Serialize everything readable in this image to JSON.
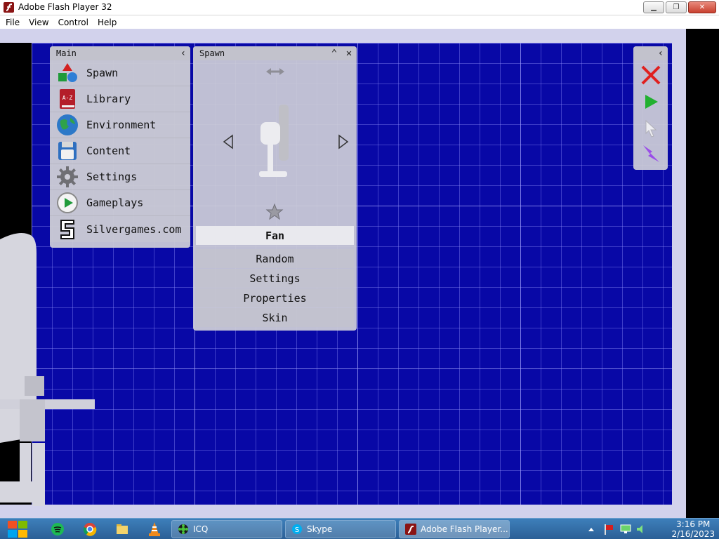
{
  "window": {
    "title": "Adobe Flash Player 32",
    "controls": [
      "minimize-icon",
      "restore-icon",
      "close-icon"
    ]
  },
  "menu": [
    "File",
    "View",
    "Control",
    "Help"
  ],
  "main_panel": {
    "title": "Main",
    "items": [
      {
        "label": "Spawn",
        "icon": "spawn-shapes-icon"
      },
      {
        "label": "Library",
        "icon": "book-icon"
      },
      {
        "label": "Environment",
        "icon": "globe-icon"
      },
      {
        "label": "Content",
        "icon": "floppy-disk-icon"
      },
      {
        "label": "Settings",
        "icon": "gear-icon"
      },
      {
        "label": "Gameplays",
        "icon": "play-icon"
      },
      {
        "label": "Silvergames.com",
        "icon": "silvergames-logo-icon"
      }
    ]
  },
  "spawn_panel": {
    "title": "Spawn",
    "selected": "Fan",
    "options": [
      "Random",
      "Settings",
      "Properties",
      "Skin"
    ]
  },
  "tools": [
    "delete-icon",
    "play-icon",
    "cursor-icon",
    "lightning-icon"
  ],
  "taskbar": {
    "windows": [
      "ICQ",
      "Skype",
      "Adobe Flash Player..."
    ],
    "time": "3:16 PM",
    "date": "2/16/2023"
  },
  "colors": {
    "stage_blue": "#0808a6",
    "grid_line": "#9696ff",
    "panel_grey": "#cdcdd7",
    "tool_red": "#e02020",
    "tool_green": "#22b030",
    "tool_purple": "#9a4de8"
  }
}
